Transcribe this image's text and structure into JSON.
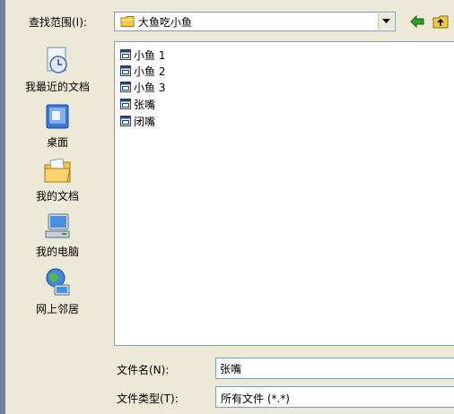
{
  "look_in": {
    "label": "查找范围(I):",
    "value": "大鱼吃小鱼"
  },
  "toolbar": {
    "back_icon": "back-arrow-icon",
    "up_icon": "up-folder-icon"
  },
  "places": [
    {
      "label": "我最近的文档",
      "icon": "recent-documents-icon"
    },
    {
      "label": "桌面",
      "icon": "desktop-icon"
    },
    {
      "label": "我的文档",
      "icon": "my-documents-icon"
    },
    {
      "label": "我的电脑",
      "icon": "my-computer-icon"
    },
    {
      "label": "网上邻居",
      "icon": "network-places-icon"
    }
  ],
  "files": [
    {
      "name": "小鱼 1"
    },
    {
      "name": "小鱼 2"
    },
    {
      "name": "小鱼 3"
    },
    {
      "name": "张嘴"
    },
    {
      "name": "闭嘴"
    }
  ],
  "file_name": {
    "label": "文件名(N):",
    "value": "张嘴"
  },
  "file_type": {
    "label": "文件类型(T):",
    "value": "所有文件 (*.*)"
  },
  "colors": {
    "dialog_bg": "#ece9d8",
    "field_border": "#7f9db9",
    "folder_yellow": "#f4c94a",
    "arrow_green": "#3c9c2c"
  }
}
